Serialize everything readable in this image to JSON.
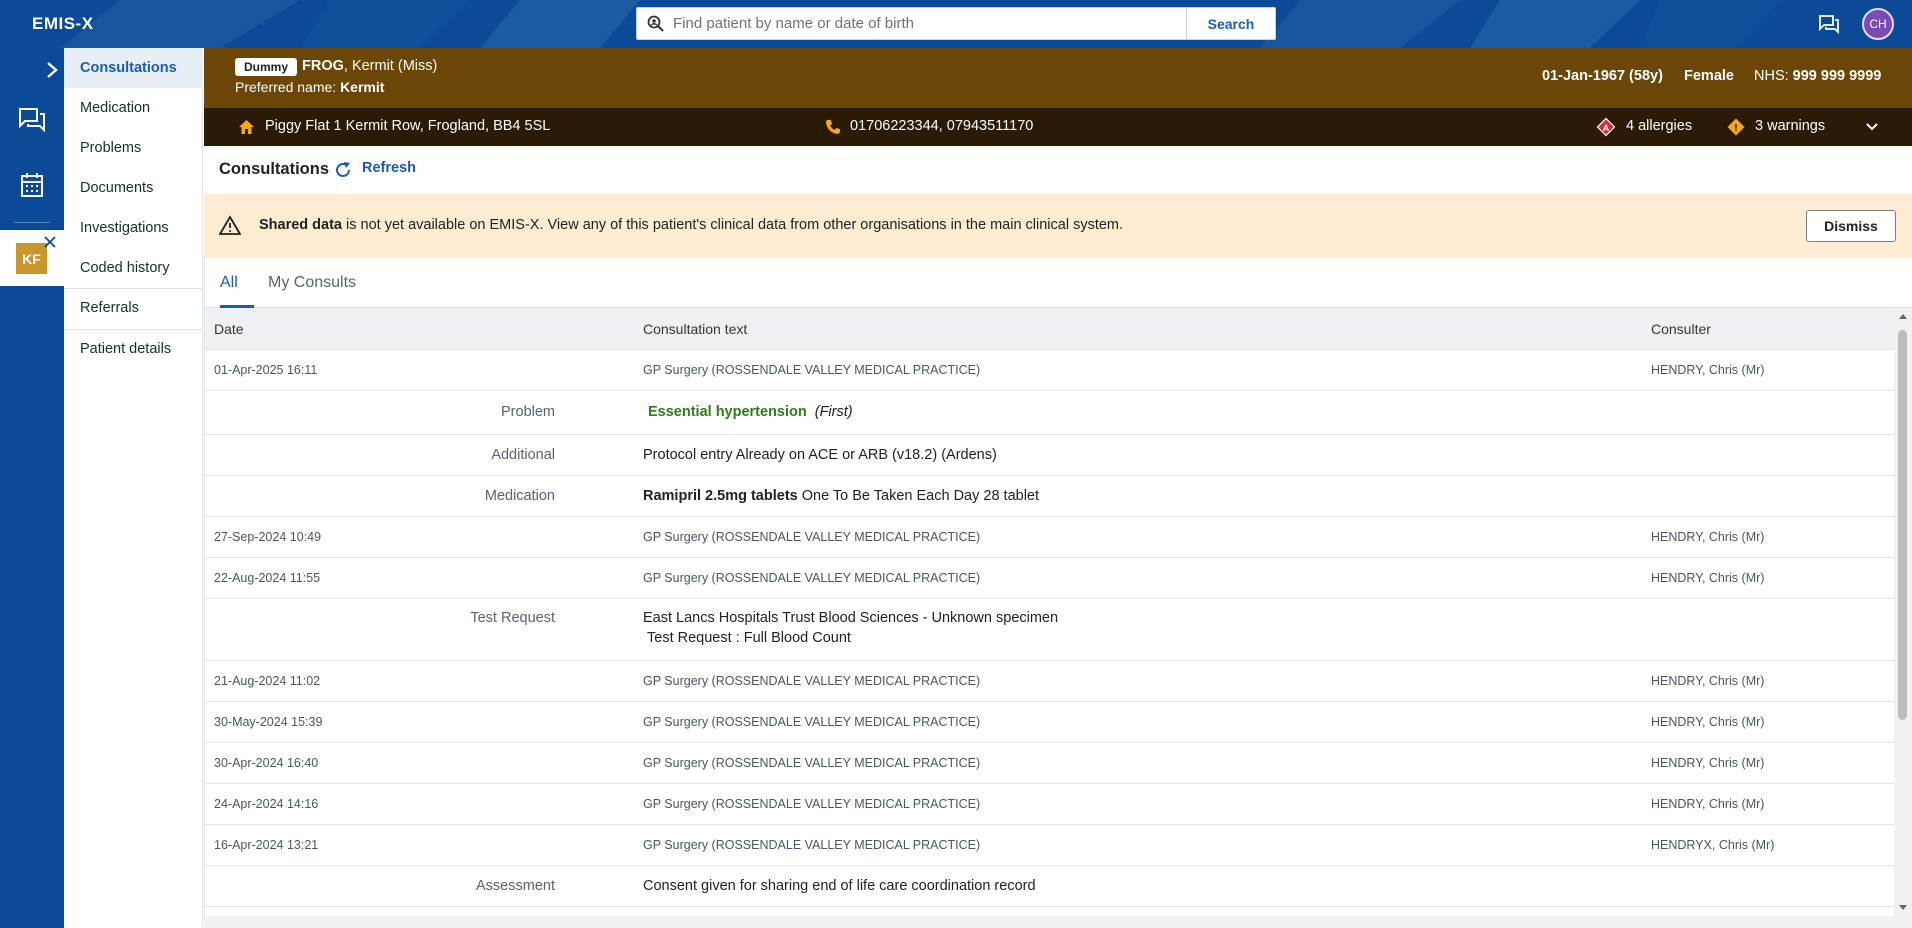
{
  "app": {
    "logo": "EMIS-X"
  },
  "search": {
    "placeholder": "Find patient by name or date of birth",
    "button_label": "Search"
  },
  "user": {
    "initials": "CH"
  },
  "rail": {
    "patient_initials": "KF"
  },
  "nav": {
    "items": [
      {
        "label": "Consultations"
      },
      {
        "label": "Medication"
      },
      {
        "label": "Problems"
      },
      {
        "label": "Documents"
      },
      {
        "label": "Investigations"
      },
      {
        "label": "Coded history"
      },
      {
        "label": "Referrals"
      },
      {
        "label": "Patient details"
      }
    ]
  },
  "patient": {
    "badge": "Dummy",
    "surname": "FROG",
    "given": ", Kermit (Miss)",
    "preferred_label": "Preferred name:",
    "preferred_name": "Kermit",
    "dob": "01-Jan-1967 (58y)",
    "gender": "Female",
    "nhs_label": "NHS:",
    "nhs_number": "999 999 9999",
    "address": "Piggy Flat 1 Kermit Row, Frogland, BB4 5SL",
    "phones": "01706223344,  07943511170",
    "allergies": "4 allergies",
    "warnings": "3 warnings"
  },
  "content": {
    "title": "Consultations",
    "refresh_label": "Refresh"
  },
  "alert": {
    "bold": "Shared data",
    "text": " is not yet available on EMIS-X. View any of this patient's clinical data from other organisations in the main clinical system.",
    "dismiss_label": "Dismiss"
  },
  "tabs": [
    {
      "label": "All"
    },
    {
      "label": "My Consults"
    }
  ],
  "table": {
    "headers": {
      "date": "Date",
      "text": "Consultation text",
      "consulter": "Consulter"
    },
    "consultations": [
      {
        "date": "01-Apr-2025 16:11",
        "org": "GP Surgery (ROSSENDALE VALLEY MEDICAL PRACTICE)",
        "consulter": "HENDRY, Chris (Mr)"
      },
      {
        "date": "27-Sep-2024 10:49",
        "org": "GP Surgery (ROSSENDALE VALLEY MEDICAL PRACTICE)",
        "consulter": "HENDRY, Chris (Mr)"
      },
      {
        "date": "22-Aug-2024 11:55",
        "org": "GP Surgery (ROSSENDALE VALLEY MEDICAL PRACTICE)",
        "consulter": "HENDRY, Chris (Mr)"
      },
      {
        "date": "21-Aug-2024 11:02",
        "org": "GP Surgery (ROSSENDALE VALLEY MEDICAL PRACTICE)",
        "consulter": "HENDRY, Chris (Mr)"
      },
      {
        "date": "30-May-2024 15:39",
        "org": "GP Surgery (ROSSENDALE VALLEY MEDICAL PRACTICE)",
        "consulter": "HENDRY, Chris (Mr)"
      },
      {
        "date": "30-Apr-2024 16:40",
        "org": "GP Surgery (ROSSENDALE VALLEY MEDICAL PRACTICE)",
        "consulter": "HENDRY, Chris (Mr)"
      },
      {
        "date": "24-Apr-2024 14:16",
        "org": "GP Surgery (ROSSENDALE VALLEY MEDICAL PRACTICE)",
        "consulter": "HENDRY, Chris (Mr)"
      },
      {
        "date": "16-Apr-2024 13:21",
        "org": "GP Surgery (ROSSENDALE VALLEY MEDICAL PRACTICE)",
        "consulter": "HENDRYX, Chris (Mr)"
      }
    ],
    "entries": {
      "problem": {
        "label": "Problem",
        "text": "Essential hypertension",
        "qualifier": "(First)"
      },
      "additional": {
        "label": "Additional",
        "text": "Protocol entry Already on ACE or ARB (v18.2) (Ardens)"
      },
      "medication": {
        "label": "Medication",
        "drug": "Ramipril 2.5mg tablets",
        "dosage": " One To Be Taken Each Day 28 tablet"
      },
      "test_request": {
        "label": "Test Request",
        "line1": "East Lancs Hospitals Trust Blood Sciences - Unknown specimen",
        "line2": "Test Request : Full Blood Count"
      },
      "assessment": {
        "label": "Assessment",
        "text": "Consent given for sharing end of life care coordination record"
      }
    }
  },
  "colors": {
    "brand_blue": "#0b4a96",
    "banner_brown": "#6b4606",
    "banner_dark": "#2b1a05",
    "link_blue": "#1a5cb0",
    "problem_green": "#2e7d1b",
    "alert_bg": "#fdecd2"
  }
}
